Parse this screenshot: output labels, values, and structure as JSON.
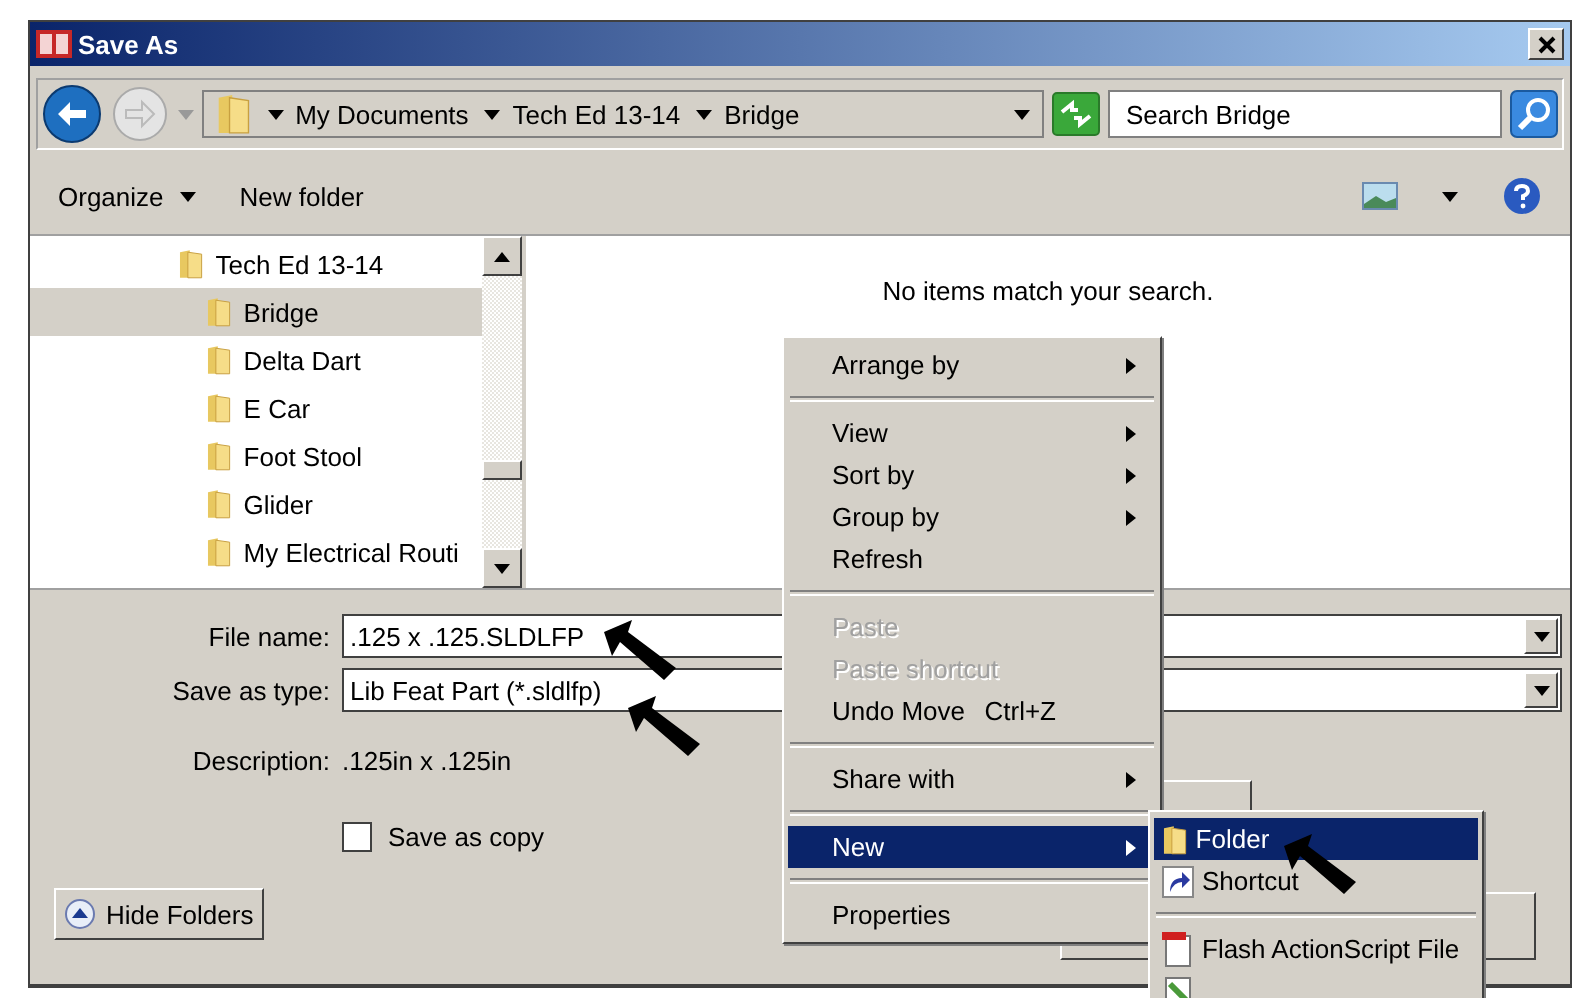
{
  "window": {
    "title": "Save As"
  },
  "address": {
    "crumbs": [
      "My Documents",
      "Tech Ed 13-14",
      "Bridge"
    ]
  },
  "search": {
    "placeholder": "Search Bridge"
  },
  "toolbar": {
    "items": [
      "Organize",
      "New folder"
    ]
  },
  "tree": {
    "items": [
      {
        "label": "Tech Ed 13-14",
        "selected": false,
        "children": [
          {
            "label": "Bridge",
            "selected": true
          },
          {
            "label": "Delta Dart",
            "selected": false
          },
          {
            "label": "E Car",
            "selected": false
          },
          {
            "label": "Foot Stool",
            "selected": false
          },
          {
            "label": "Glider",
            "selected": false
          },
          {
            "label": "My Electrical Routi",
            "selected": false
          }
        ]
      }
    ]
  },
  "files": {
    "empty_message": "No items match your search."
  },
  "form": {
    "file_name_label": "File name:",
    "file_name": ".125 x .125.SLDLFP",
    "type_label": "Save as type:",
    "type": "Lib Feat Part (*.sldlfp)",
    "description_label": "Description:",
    "description": ".125in x .125in",
    "save_as_copy": {
      "label": "Save as copy",
      "checked": false
    },
    "hide_folders": "Hide Folders"
  },
  "context_menu": {
    "items": [
      {
        "kind": "item",
        "label": "Arrange by",
        "submenu": true,
        "disabled": false,
        "selected": false
      },
      {
        "kind": "separator"
      },
      {
        "kind": "item",
        "label": "View",
        "submenu": true,
        "disabled": false,
        "selected": false
      },
      {
        "kind": "item",
        "label": "Sort by",
        "submenu": true,
        "disabled": false,
        "selected": false
      },
      {
        "kind": "item",
        "label": "Group by",
        "submenu": true,
        "disabled": false,
        "selected": false
      },
      {
        "kind": "item",
        "label": "Refresh",
        "submenu": false,
        "disabled": false,
        "selected": false
      },
      {
        "kind": "separator"
      },
      {
        "kind": "item",
        "label": "Paste",
        "submenu": false,
        "disabled": true,
        "selected": false
      },
      {
        "kind": "item",
        "label": "Paste shortcut",
        "submenu": false,
        "disabled": true,
        "selected": false
      },
      {
        "kind": "item",
        "label": "Undo Move",
        "shortcut": "Ctrl+Z",
        "submenu": false,
        "disabled": false,
        "selected": false
      },
      {
        "kind": "separator"
      },
      {
        "kind": "item",
        "label": "Share with",
        "submenu": true,
        "disabled": false,
        "selected": false
      },
      {
        "kind": "separator"
      },
      {
        "kind": "item",
        "label": "New",
        "submenu": true,
        "disabled": false,
        "selected": true
      },
      {
        "kind": "separator"
      },
      {
        "kind": "item",
        "label": "Properties",
        "submenu": false,
        "disabled": false,
        "selected": false
      }
    ]
  },
  "submenu": {
    "items": [
      {
        "kind": "item",
        "label": "Folder",
        "selected": true
      },
      {
        "kind": "item",
        "label": "Shortcut",
        "selected": false
      },
      {
        "kind": "separator"
      },
      {
        "kind": "item",
        "label": "Flash ActionScript File",
        "selected": false
      }
    ]
  }
}
